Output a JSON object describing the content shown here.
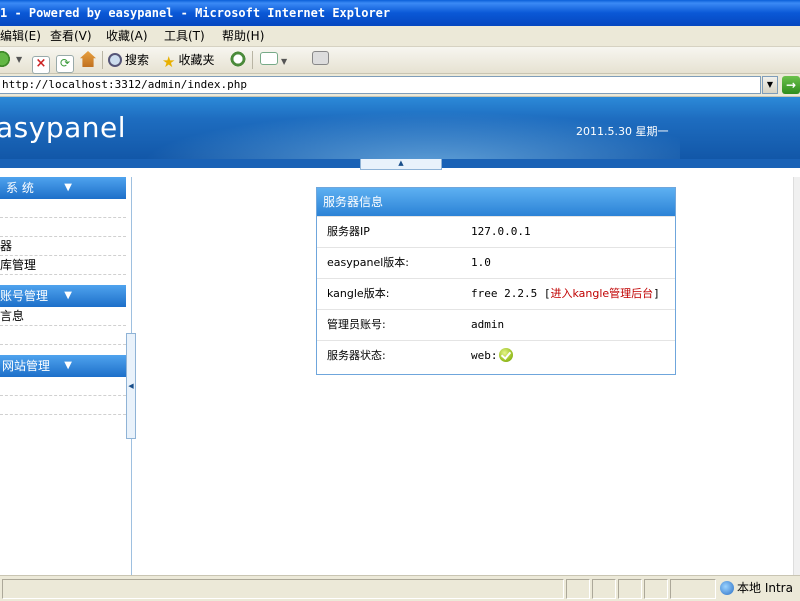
{
  "window": {
    "title": "1 - Powered by easypanel - Microsoft Internet Explorer"
  },
  "menubar": {
    "items": [
      "编辑(E)",
      "查看(V)",
      "收藏(A)",
      "工具(T)",
      "帮助(H)"
    ]
  },
  "toolbar": {
    "search_label": "搜索",
    "favorites_label": "收藏夹"
  },
  "address": {
    "url": "http://localhost:3312/admin/index.php"
  },
  "banner": {
    "logo_text": "asypanel",
    "date_text": "2011.5.30 星期一"
  },
  "sidebar": {
    "sections": [
      {
        "title": "系 统",
        "items": [
          "",
          "",
          "器",
          "库管理"
        ]
      },
      {
        "title": "账号管理",
        "items": [
          "言息",
          ""
        ]
      },
      {
        "title": "网站管理",
        "items": [
          "",
          ""
        ]
      }
    ]
  },
  "server_info": {
    "title": "服务器信息",
    "rows": [
      {
        "label": "服务器IP",
        "value": "127.0.0.1"
      },
      {
        "label": "easypanel版本:",
        "value": "1.0"
      },
      {
        "label": "kangle版本:",
        "value": "free 2.2.5",
        "link_open": "[",
        "link_text": "进入kangle管理后台",
        "link_close": "]"
      },
      {
        "label": "管理员账号:",
        "value": "admin"
      },
      {
        "label": "服务器状态:",
        "value": "web:"
      }
    ]
  },
  "statusbar": {
    "zone_text": "本地 Intra"
  }
}
